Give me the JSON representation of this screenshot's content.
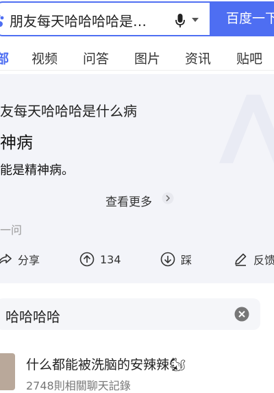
{
  "search": {
    "query": "朋友每天哈哈哈哈是…",
    "button_label": "百度一下"
  },
  "tabs": [
    {
      "label": "部",
      "active": true
    },
    {
      "label": "视频",
      "active": false
    },
    {
      "label": "问答",
      "active": false
    },
    {
      "label": "图片",
      "active": false
    },
    {
      "label": "资讯",
      "active": false
    },
    {
      "label": "贴吧",
      "active": false
    }
  ],
  "answer": {
    "question": "友每天哈哈哈是什么病",
    "headline": "神病",
    "detail": "能是精神病。",
    "more_label": "查看更多",
    "source_snippet": "一问",
    "actions": {
      "share": "分享",
      "upvote_count": "134",
      "downvote": "踩",
      "feedback": "反馈"
    }
  },
  "inline_search": {
    "value": "哈哈哈哈"
  },
  "result": {
    "title": "什么都能被洗脑的安辣辣🐿",
    "subtitle": "2748則相關聊天記錄"
  },
  "colors": {
    "accent": "#4e6ef2",
    "card_bg": "#f3f4f9"
  }
}
